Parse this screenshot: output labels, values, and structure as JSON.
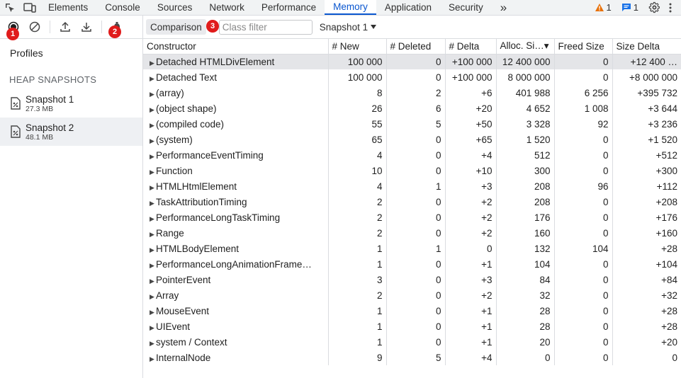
{
  "tabs": [
    "Elements",
    "Console",
    "Sources",
    "Network",
    "Performance",
    "Memory",
    "Application",
    "Security"
  ],
  "more_tabs": "»",
  "warnings_count": "1",
  "messages_count": "1",
  "sidebar": {
    "profiles_label": "Profiles",
    "section_label": "HEAP SNAPSHOTS",
    "snapshots": [
      {
        "name": "Snapshot 1",
        "size": "27.3 MB"
      },
      {
        "name": "Snapshot 2",
        "size": "48.1 MB"
      }
    ],
    "badge1": "1",
    "badge2": "2"
  },
  "toolbar": {
    "view": "Comparison",
    "badge3": "3",
    "filter_placeholder": "Class filter",
    "base_snapshot": "Snapshot 1"
  },
  "columns": [
    "Constructor",
    "# New",
    "# Deleted",
    "# Delta",
    "Alloc. Si…▾",
    "Freed Size",
    "Size Delta"
  ],
  "rows": [
    {
      "name": "Detached HTMLDivElement",
      "new": "100 000",
      "deleted": "0",
      "delta": "+100 000",
      "alloc": "12 400 000",
      "freed": "0",
      "size_delta": "+12 400 …"
    },
    {
      "name": "Detached Text",
      "new": "100 000",
      "deleted": "0",
      "delta": "+100 000",
      "alloc": "8 000 000",
      "freed": "0",
      "size_delta": "+8 000 000"
    },
    {
      "name": "(array)",
      "new": "8",
      "deleted": "2",
      "delta": "+6",
      "alloc": "401 988",
      "freed": "6 256",
      "size_delta": "+395 732"
    },
    {
      "name": "(object shape)",
      "new": "26",
      "deleted": "6",
      "delta": "+20",
      "alloc": "4 652",
      "freed": "1 008",
      "size_delta": "+3 644"
    },
    {
      "name": "(compiled code)",
      "new": "55",
      "deleted": "5",
      "delta": "+50",
      "alloc": "3 328",
      "freed": "92",
      "size_delta": "+3 236"
    },
    {
      "name": "(system)",
      "new": "65",
      "deleted": "0",
      "delta": "+65",
      "alloc": "1 520",
      "freed": "0",
      "size_delta": "+1 520"
    },
    {
      "name": "PerformanceEventTiming",
      "new": "4",
      "deleted": "0",
      "delta": "+4",
      "alloc": "512",
      "freed": "0",
      "size_delta": "+512"
    },
    {
      "name": "Function",
      "new": "10",
      "deleted": "0",
      "delta": "+10",
      "alloc": "300",
      "freed": "0",
      "size_delta": "+300"
    },
    {
      "name": "HTMLHtmlElement",
      "new": "4",
      "deleted": "1",
      "delta": "+3",
      "alloc": "208",
      "freed": "96",
      "size_delta": "+112"
    },
    {
      "name": "TaskAttributionTiming",
      "new": "2",
      "deleted": "0",
      "delta": "+2",
      "alloc": "208",
      "freed": "0",
      "size_delta": "+208"
    },
    {
      "name": "PerformanceLongTaskTiming",
      "new": "2",
      "deleted": "0",
      "delta": "+2",
      "alloc": "176",
      "freed": "0",
      "size_delta": "+176"
    },
    {
      "name": "Range",
      "new": "2",
      "deleted": "0",
      "delta": "+2",
      "alloc": "160",
      "freed": "0",
      "size_delta": "+160"
    },
    {
      "name": "HTMLBodyElement",
      "new": "1",
      "deleted": "1",
      "delta": "0",
      "alloc": "132",
      "freed": "104",
      "size_delta": "+28"
    },
    {
      "name": "PerformanceLongAnimationFrame…",
      "new": "1",
      "deleted": "0",
      "delta": "+1",
      "alloc": "104",
      "freed": "0",
      "size_delta": "+104"
    },
    {
      "name": "PointerEvent",
      "new": "3",
      "deleted": "0",
      "delta": "+3",
      "alloc": "84",
      "freed": "0",
      "size_delta": "+84"
    },
    {
      "name": "Array",
      "new": "2",
      "deleted": "0",
      "delta": "+2",
      "alloc": "32",
      "freed": "0",
      "size_delta": "+32"
    },
    {
      "name": "MouseEvent",
      "new": "1",
      "deleted": "0",
      "delta": "+1",
      "alloc": "28",
      "freed": "0",
      "size_delta": "+28"
    },
    {
      "name": "UIEvent",
      "new": "1",
      "deleted": "0",
      "delta": "+1",
      "alloc": "28",
      "freed": "0",
      "size_delta": "+28"
    },
    {
      "name": "system / Context",
      "new": "1",
      "deleted": "0",
      "delta": "+1",
      "alloc": "20",
      "freed": "0",
      "size_delta": "+20"
    },
    {
      "name": "InternalNode",
      "new": "9",
      "deleted": "5",
      "delta": "+4",
      "alloc": "0",
      "freed": "0",
      "size_delta": "0"
    }
  ],
  "colors": {
    "accent": "#0b57d0",
    "badge": "#e01b1b",
    "warning": "#e8710a"
  }
}
